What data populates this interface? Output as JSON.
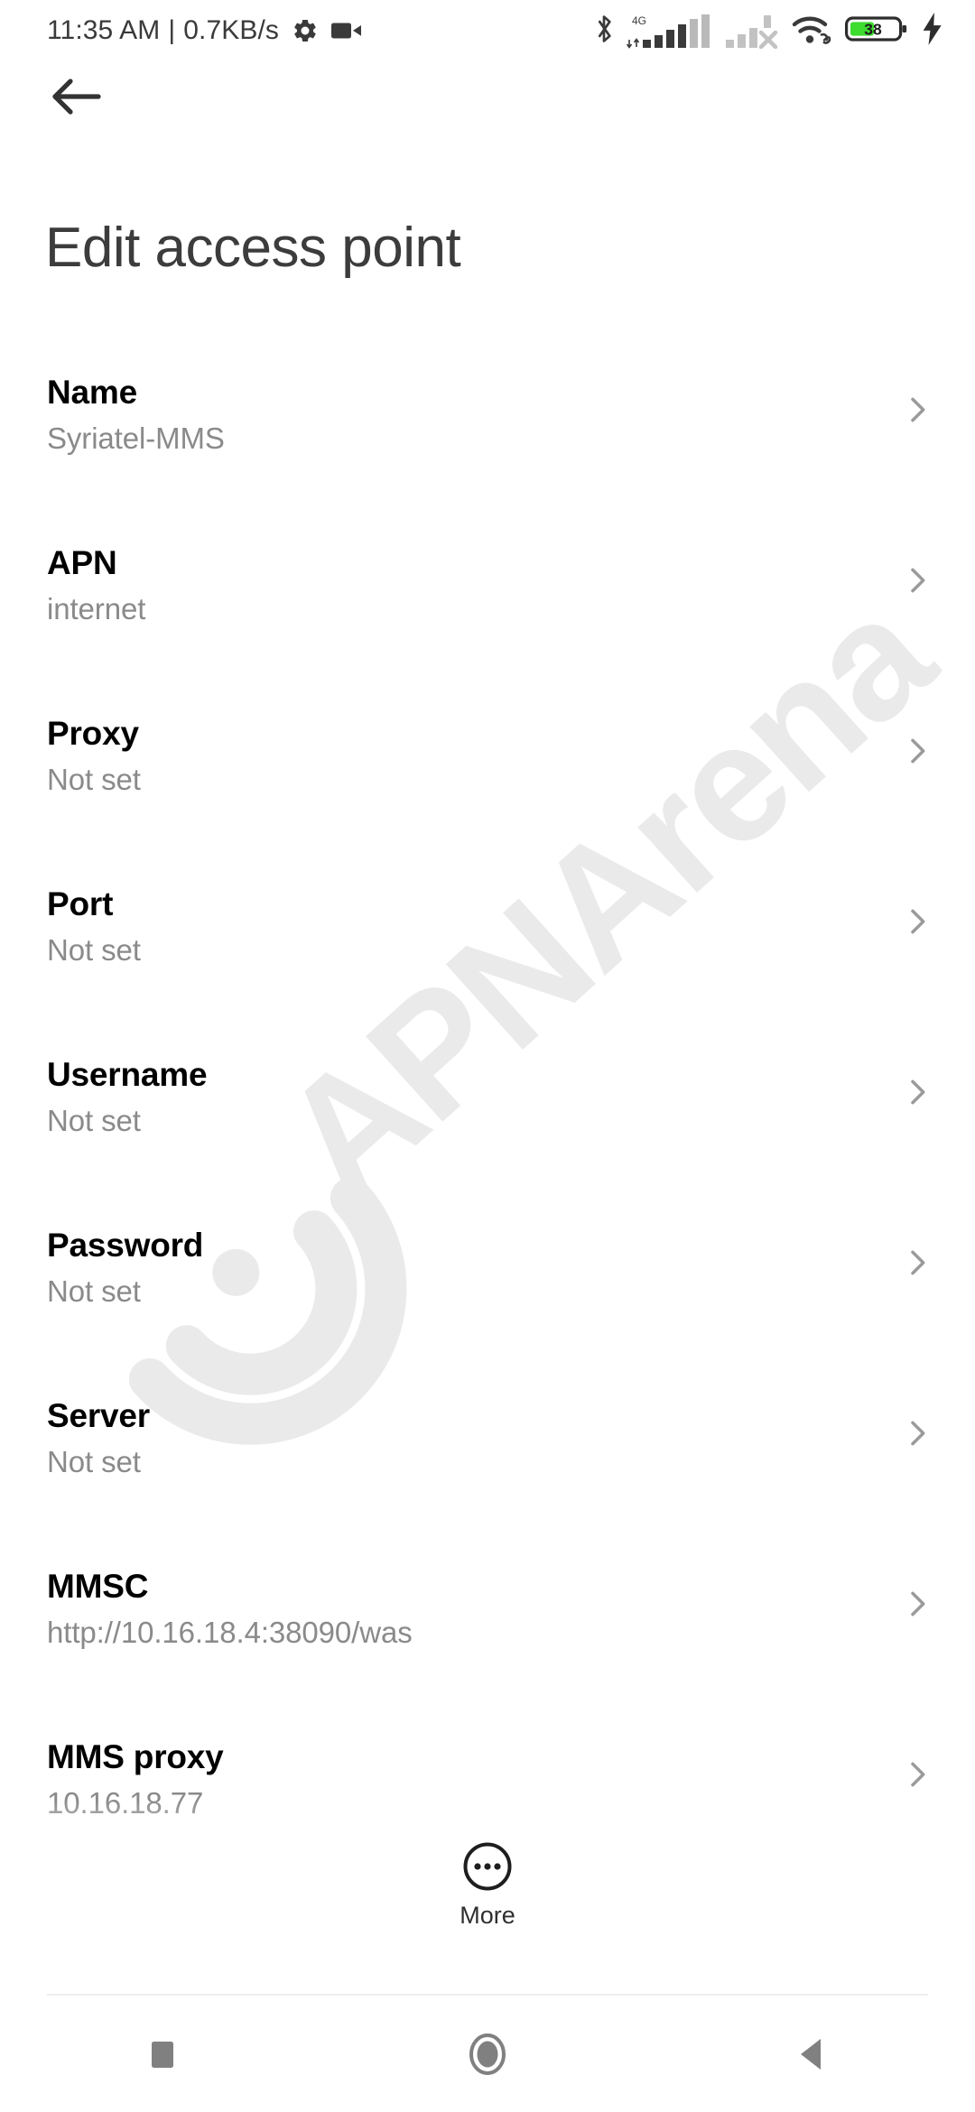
{
  "status_bar": {
    "time": "11:35 AM",
    "separator": "|",
    "net_speed": "0.7KB/s",
    "icons_left": [
      "gear-icon",
      "video-recording-icon"
    ],
    "icons_right": [
      "bluetooth-icon",
      "signal-4g-icon",
      "signal-sim2-off-icon",
      "wifi-icon",
      "battery-icon",
      "charging-bolt-icon"
    ],
    "network_type": "4G",
    "battery_percent": "38",
    "battery_fill_color": "#3ddc2f"
  },
  "app_bar": {
    "back_icon": "arrow-left-icon",
    "title": "Edit access point"
  },
  "list": {
    "chevron_icon": "chevron-right-icon",
    "items": [
      {
        "title": "Name",
        "summary": "Syriatel-MMS"
      },
      {
        "title": "APN",
        "summary": "internet"
      },
      {
        "title": "Proxy",
        "summary": "Not set"
      },
      {
        "title": "Port",
        "summary": "Not set"
      },
      {
        "title": "Username",
        "summary": "Not set"
      },
      {
        "title": "Password",
        "summary": "Not set"
      },
      {
        "title": "Server",
        "summary": "Not set"
      },
      {
        "title": "MMSC",
        "summary": "http://10.16.18.4:38090/was"
      },
      {
        "title": "MMS proxy",
        "summary": "10.16.18.77"
      }
    ]
  },
  "more_button": {
    "label": "More",
    "icon": "more-circle-icon"
  },
  "nav_bar": {
    "recents_icon": "square-recents-icon",
    "home_icon": "circle-home-icon",
    "back_icon": "triangle-back-icon"
  },
  "watermark": {
    "text": "APNArena",
    "color": "#eaeaea"
  }
}
